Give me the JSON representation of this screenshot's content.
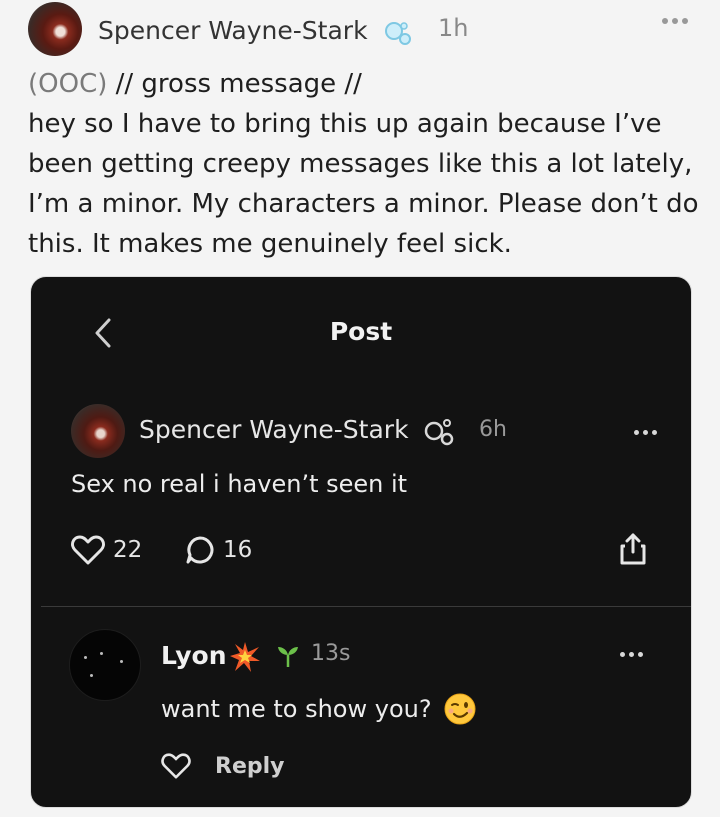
{
  "post": {
    "author": "Spencer Wayne-Stark",
    "time": "1h",
    "ooc_tag": "(OOC)",
    "ooc_rest": "// gross message //",
    "body": "hey so I have to bring this up again because I’ve been getting creepy messages like this a lot lately, I’m a minor. My characters a minor. Please don’t do this. It makes me genuinely feel sick."
  },
  "screenshot": {
    "title": "Post",
    "author": "Spencer Wayne-Stark",
    "time": "6h",
    "text": "Sex no real i haven’t seen it",
    "likes": "22",
    "comments": "16",
    "comment": {
      "author": "Lyon",
      "time": "13s",
      "text": "want me to show you?",
      "reply_label": "Reply"
    }
  },
  "icons": [
    "bubbles-icon",
    "more-icon",
    "back-icon",
    "heart-icon",
    "comment-icon",
    "share-icon",
    "spark-icon",
    "sprout-icon",
    "wink-emoji-icon"
  ]
}
